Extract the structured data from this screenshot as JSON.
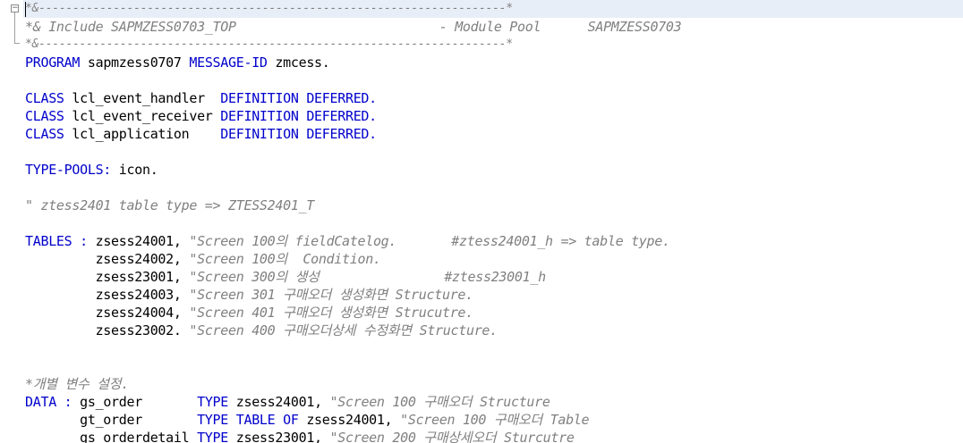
{
  "colors": {
    "keyword": "#0000cc",
    "comment": "#808080",
    "text": "#000000",
    "current_line": "#e8eef7"
  },
  "editor": {
    "fold_icon": "collapse-minus-icon",
    "lines": [
      {
        "small": true,
        "tokens": [
          {
            "t": "cm",
            "v": "*&---------------------------------------------------------------------*"
          }
        ]
      },
      {
        "tokens": [
          {
            "t": "cm",
            "v": "*& Include SAPMZESS0703_TOP                          - Module Pool      SAPMZESS0703"
          }
        ]
      },
      {
        "small": true,
        "tokens": [
          {
            "t": "cm",
            "v": "*&---------------------------------------------------------------------*"
          }
        ]
      },
      {
        "tokens": [
          {
            "t": "kw",
            "v": "PROGRAM"
          },
          {
            "t": "id",
            "v": " sapmzess0707 "
          },
          {
            "t": "kw",
            "v": "MESSAGE-ID"
          },
          {
            "t": "id",
            "v": " zmcess."
          }
        ]
      },
      {
        "tokens": []
      },
      {
        "tokens": [
          {
            "t": "kw",
            "v": "CLASS"
          },
          {
            "t": "id",
            "v": " lcl_event_handler  "
          },
          {
            "t": "kw",
            "v": "DEFINITION DEFERRED."
          }
        ]
      },
      {
        "tokens": [
          {
            "t": "kw",
            "v": "CLASS"
          },
          {
            "t": "id",
            "v": " lcl_event_receiver "
          },
          {
            "t": "kw",
            "v": "DEFINITION DEFERRED."
          }
        ]
      },
      {
        "tokens": [
          {
            "t": "kw",
            "v": "CLASS"
          },
          {
            "t": "id",
            "v": " lcl_application    "
          },
          {
            "t": "kw",
            "v": "DEFINITION DEFERRED."
          }
        ]
      },
      {
        "tokens": []
      },
      {
        "tokens": [
          {
            "t": "kw",
            "v": "TYPE-POOLS:"
          },
          {
            "t": "id",
            "v": " icon."
          }
        ]
      },
      {
        "tokens": []
      },
      {
        "tokens": [
          {
            "t": "cm",
            "v": "\" ztess2401 table type => ZTESS2401_T"
          }
        ]
      },
      {
        "tokens": []
      },
      {
        "tokens": [
          {
            "t": "kw",
            "v": "TABLES :"
          },
          {
            "t": "id",
            "v": " zsess24001, "
          },
          {
            "t": "cm",
            "v": "\"Screen 100의 fieldCatelog.       #ztess24001_h => table type."
          }
        ]
      },
      {
        "tokens": [
          {
            "t": "id",
            "v": "         zsess24002, "
          },
          {
            "t": "cm",
            "v": "\"Screen 100의  Condition."
          }
        ]
      },
      {
        "tokens": [
          {
            "t": "id",
            "v": "         zsess23001, "
          },
          {
            "t": "cm",
            "v": "\"Screen 300의 생성                #ztess23001_h"
          }
        ]
      },
      {
        "tokens": [
          {
            "t": "id",
            "v": "         zsess24003, "
          },
          {
            "t": "cm",
            "v": "\"Screen 301 구매오더 생성화면 Structure."
          }
        ]
      },
      {
        "tokens": [
          {
            "t": "id",
            "v": "         zsess24004, "
          },
          {
            "t": "cm",
            "v": "\"Screen 401 구매오더 생성화면 Strucutre."
          }
        ]
      },
      {
        "tokens": [
          {
            "t": "id",
            "v": "         zsess23002. "
          },
          {
            "t": "cm",
            "v": "\"Screen 400 구매오더상세 수정화면 Structure."
          }
        ]
      },
      {
        "tokens": []
      },
      {
        "tokens": []
      },
      {
        "tokens": [
          {
            "t": "cm",
            "v": "*개별 변수 설정."
          }
        ]
      },
      {
        "tokens": [
          {
            "t": "kw",
            "v": "DATA :"
          },
          {
            "t": "id",
            "v": " gs_order       "
          },
          {
            "t": "kw",
            "v": "TYPE"
          },
          {
            "t": "id",
            "v": " zsess24001, "
          },
          {
            "t": "cm",
            "v": "\"Screen 100 구매오더 Structure"
          }
        ]
      },
      {
        "tokens": [
          {
            "t": "id",
            "v": "       gt_order       "
          },
          {
            "t": "kw",
            "v": "TYPE TABLE OF"
          },
          {
            "t": "id",
            "v": " zsess24001, "
          },
          {
            "t": "cm",
            "v": "\"Screen 100 구매오더 Table"
          }
        ]
      },
      {
        "tokens": [
          {
            "t": "id",
            "v": "       gs_orderdetail "
          },
          {
            "t": "kw",
            "v": "TYPE"
          },
          {
            "t": "id",
            "v": " zsess23001, "
          },
          {
            "t": "cm",
            "v": "\"Screen 200 구매상세오더 Sturcutre"
          }
        ]
      }
    ]
  }
}
